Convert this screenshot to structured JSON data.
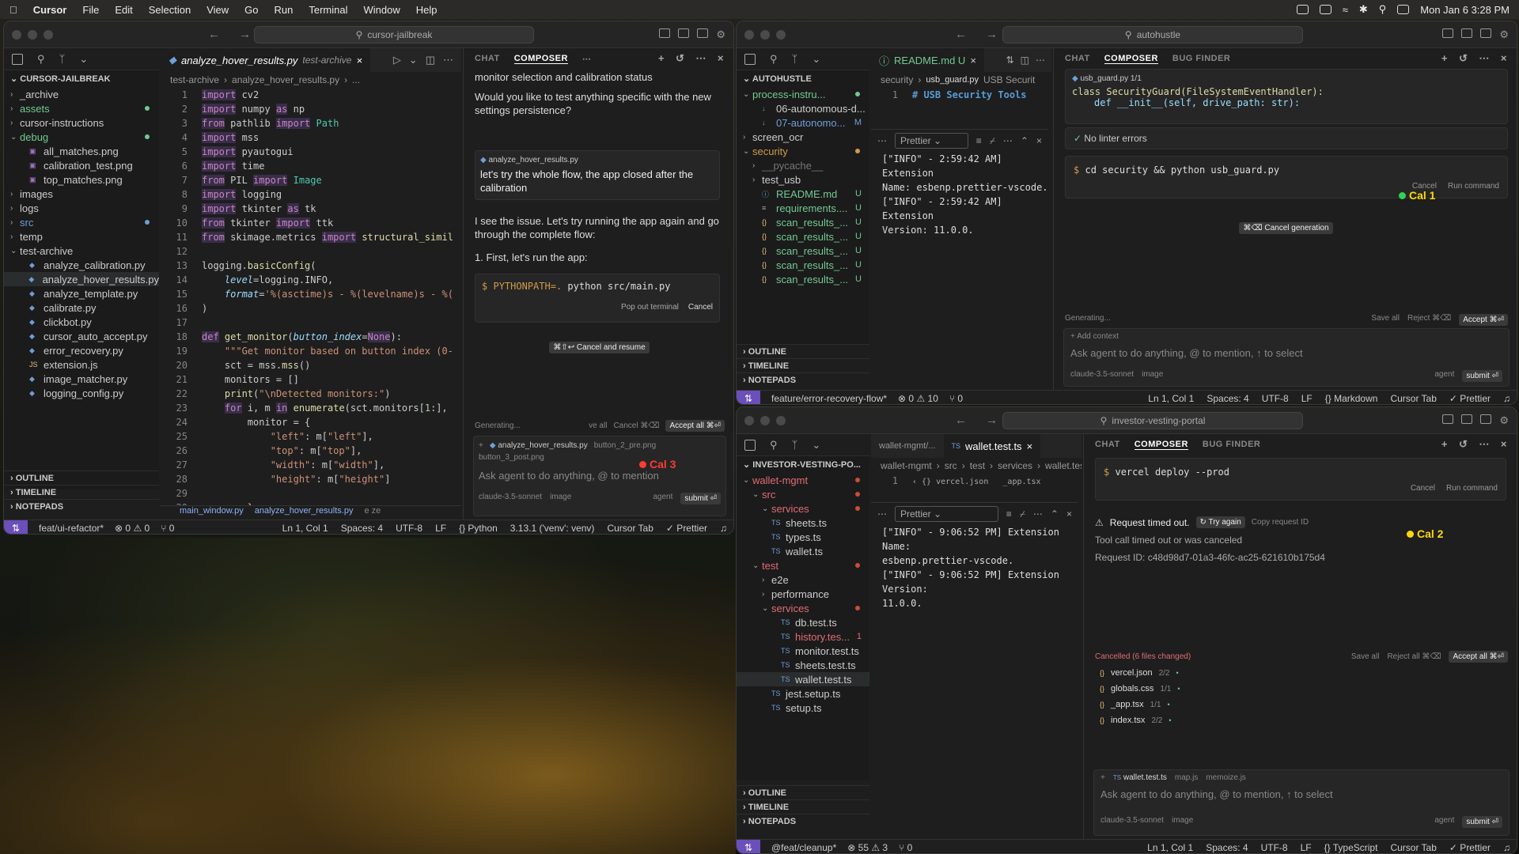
{
  "menubar": {
    "app": "Cursor",
    "items": [
      "File",
      "Edit",
      "Selection",
      "View",
      "Go",
      "Run",
      "Terminal",
      "Window",
      "Help"
    ],
    "clock": "Mon Jan 6  3:28 PM"
  },
  "win1": {
    "search": "cursor-jailbreak",
    "root": "CURSOR-JAILBREAK",
    "tree": [
      {
        "label": "_archive",
        "chev": ">",
        "indent": 0,
        "kind": "folder"
      },
      {
        "label": "assets",
        "chev": ">",
        "indent": 0,
        "kind": "folder",
        "color": "#73c991",
        "dot": "g"
      },
      {
        "label": "cursor-instructions",
        "chev": ">",
        "indent": 0,
        "kind": "folder"
      },
      {
        "label": "debug",
        "chev": "v",
        "indent": 0,
        "kind": "folder",
        "color": "#73c991",
        "dot": "g"
      },
      {
        "label": "all_matches.png",
        "indent": 1,
        "kind": "img"
      },
      {
        "label": "calibration_test.png",
        "indent": 1,
        "kind": "img"
      },
      {
        "label": "top_matches.png",
        "indent": 1,
        "kind": "img"
      },
      {
        "label": "images",
        "chev": ">",
        "indent": 0,
        "kind": "folder"
      },
      {
        "label": "logs",
        "chev": ">",
        "indent": 0,
        "kind": "folder"
      },
      {
        "label": "src",
        "chev": ">",
        "indent": 0,
        "kind": "folder",
        "color": "#6f9fd8",
        "dot": "b2"
      },
      {
        "label": "temp",
        "chev": ">",
        "indent": 0,
        "kind": "folder"
      },
      {
        "label": "test-archive",
        "chev": "v",
        "indent": 0,
        "kind": "folder"
      },
      {
        "label": "analyze_calibration.py",
        "indent": 1,
        "kind": "py"
      },
      {
        "label": "analyze_hover_results.py",
        "indent": 1,
        "kind": "py",
        "sel": true
      },
      {
        "label": "analyze_template.py",
        "indent": 1,
        "kind": "py"
      },
      {
        "label": "calibrate.py",
        "indent": 1,
        "kind": "py"
      },
      {
        "label": "clickbot.py",
        "indent": 1,
        "kind": "py"
      },
      {
        "label": "cursor_auto_accept.py",
        "indent": 1,
        "kind": "py"
      },
      {
        "label": "error_recovery.py",
        "indent": 1,
        "kind": "py"
      },
      {
        "label": "extension.js",
        "indent": 1,
        "kind": "js"
      },
      {
        "label": "image_matcher.py",
        "indent": 1,
        "kind": "py"
      },
      {
        "label": "logging_config.py",
        "indent": 1,
        "kind": "py"
      }
    ],
    "sections": [
      "OUTLINE",
      "TIMELINE",
      "NOTEPADS"
    ],
    "tab": {
      "name": "analyze_hover_results.py",
      "folder": "test-archive"
    },
    "breadcrumb": [
      "test-archive",
      "analyze_hover_results.py",
      "..."
    ],
    "code": [
      "<span class='kw'>import</span> cv2",
      "<span class='kw'>import</span> numpy <span class='kw'>as</span> np",
      "<span class='kw'>from</span> pathlib <span class='kw'>import</span> <span class='cls'>Path</span>",
      "<span class='kw'>import</span> mss",
      "<span class='kw'>import</span> pyautogui",
      "<span class='kw'>import</span> time",
      "<span class='kw'>from</span> PIL <span class='kw'>import</span> <span class='cls'>Image</span>",
      "<span class='kw'>import</span> logging",
      "<span class='kw'>import</span> tkinter <span class='kw'>as</span> tk",
      "<span class='kw'>from</span> tkinter <span class='kw'>import</span> ttk",
      "<span class='kw'>from</span> skimage.metrics <span class='kw'>import</span> <span class='fn'>structural_simil</span>",
      "",
      "logging.<span class='fn'>basicConfig</span>(",
      "    <span class='par'>level</span>=logging.INFO,",
      "    <span class='par'>format</span>=<span class='str'>'%(asctime)s - %(levelname)s - %(</span>",
      ")",
      "",
      "<span class='kw'>def</span> <span class='fn'>get_monitor</span>(<span class='par'>button_index</span>=<span class='kw'>None</span>):",
      "    <span class='str'>\"\"\"Get monitor based on button index (0-</span>",
      "    sct = mss.<span class='fn'>mss</span>()",
      "    monitors = []",
      "    <span class='fn'>print</span>(<span class='str'>\"\\nDetected monitors:\"</span>)",
      "    <span class='kw'>for</span> i, m <span class='kw'>in</span> <span class='fn'>enumerate</span>(sct.monitors[<span class='num'>1</span>:],",
      "        monitor = {",
      "            <span class='str'>\"left\"</span>: m[<span class='str'>\"left\"</span>],",
      "            <span class='str'>\"top\"</span>: m[<span class='str'>\"top\"</span>],",
      "            <span class='str'>\"width\"</span>: m[<span class='str'>\"width\"</span>],",
      "            <span class='str'>\"height\"</span>: m[<span class='str'>\"height\"</span>]",
      "",
      "        }"
    ],
    "sticky": [
      "main_window.py",
      "analyze_hover_results.py",
      "e ze"
    ],
    "chat": {
      "tabs": [
        "CHAT",
        "COMPOSER"
      ],
      "prev_text": "monitor selection and calibration status",
      "q": "Would you like to test anything specific with the new settings persistence?",
      "user_file": "analyze_hover_results.py",
      "user_msg": "let's try the whole flow, the app closed after the calibration",
      "reply": "I see the issue. Let's try running the app again and go through the complete flow:",
      "step": "1. First, let's run the app:",
      "cmd_prefix": "PYTHONPATH=.",
      "cmd_rest": "python src/main.py",
      "popout": "Pop out terminal",
      "cancel": "Cancel",
      "cancel_resume": "⌘⇧↩ Cancel and resume",
      "generating": "Generating...",
      "save_all": "ve all",
      "cancel_k": "Cancel ⌘⌫",
      "accept_all": "Accept all ⌘⏎",
      "ctx_files": [
        "analyze_hover_results.py",
        "button_2_pre.png",
        "button_3_post.png"
      ],
      "ask": "Ask agent to do anything, @ to mention",
      "model": "claude-3.5-sonnet",
      "image": "image",
      "agent": "agent",
      "submit": "submit ⏎"
    },
    "cal3": "Cal 3",
    "status": {
      "branch": "feat/ui-refactor*",
      "errors": "⊗ 0 ⚠ 0",
      "ports": "⑂ 0",
      "pos": "Ln 1, Col 1",
      "spaces": "Spaces: 4",
      "enc": "UTF-8",
      "eol": "LF",
      "lang": "{} Python",
      "ver": "3.13.1 ('venv': venv)",
      "tab": "Cursor Tab",
      "prettier": "✓ Prettier"
    }
  },
  "win2": {
    "search": "autohustle",
    "root": "AUTOHUSTLE",
    "tree": [
      {
        "label": "process-instru...",
        "chev": "v",
        "indent": 0,
        "kind": "folder",
        "color": "#73c991",
        "dot": "g"
      },
      {
        "label": "06-autonomous-d...",
        "indent": 1,
        "kind": "md"
      },
      {
        "label": "07-autonomo...",
        "indent": 1,
        "kind": "md",
        "color": "#6f9fd8",
        "badge": "M"
      },
      {
        "label": "screen_ocr",
        "chev": ">",
        "indent": 0,
        "kind": "folder"
      },
      {
        "label": "security",
        "chev": "v",
        "indent": 0,
        "kind": "folder",
        "color": "#d19a4b",
        "dot": "r"
      },
      {
        "label": "__pycache__",
        "chev": ">",
        "indent": 1,
        "kind": "folder",
        "color": "#777"
      },
      {
        "label": "test_usb",
        "chev": ">",
        "indent": 1,
        "kind": "folder"
      },
      {
        "label": "README.md",
        "indent": 1,
        "kind": "info",
        "color": "#73c991",
        "badge": "U"
      },
      {
        "label": "requirements....",
        "indent": 1,
        "kind": "txt",
        "color": "#73c991",
        "badge": "U"
      },
      {
        "label": "scan_results_...",
        "indent": 1,
        "kind": "json",
        "color": "#73c991",
        "badge": "U"
      },
      {
        "label": "scan_results_...",
        "indent": 1,
        "kind": "json",
        "color": "#73c991",
        "badge": "U"
      },
      {
        "label": "scan_results_...",
        "indent": 1,
        "kind": "json",
        "color": "#73c991",
        "badge": "U"
      },
      {
        "label": "scan_results_...",
        "indent": 1,
        "kind": "json",
        "color": "#73c991",
        "badge": "U"
      },
      {
        "label": "scan_results_...",
        "indent": 1,
        "kind": "json",
        "color": "#73c991",
        "badge": "U"
      }
    ],
    "sections": [
      "OUTLINE",
      "TIMELINE",
      "NOTEPADS"
    ],
    "tab": "README.md U",
    "crumb": [
      "security",
      "usb_guard.py",
      "USB Securit"
    ],
    "line1": "# USB Security Tools",
    "term_lines": [
      "[\"INFO\" - 2:59:42 AM] Extension",
      "Name: esbenp.prettier-vscode.",
      "[\"INFO\" - 2:59:42 AM] Extension",
      "Version: 11.0.0."
    ],
    "prettier": "Prettier",
    "chat": {
      "tabs": [
        "CHAT",
        "COMPOSER",
        "BUG FINDER"
      ],
      "file": "usb_guard.py",
      "file_count": "1/1",
      "code1": "class SecurityGuard(FileSystemEventHandler):",
      "code2": "def __init__(self, drive_path: str):",
      "lint": "No linter errors",
      "cmd": "cd security && python usb_guard.py",
      "cancel": "Cancel",
      "run": "Run command",
      "cancel_gen": "⌘⌫ Cancel generation",
      "generating": "Generating...",
      "save_all": "Save all",
      "reject": "Reject ⌘⌫",
      "accept": "Accept ⌘⏎",
      "add_ctx": "+ Add context",
      "ask": "Ask agent to do anything, @ to mention, ↑ to select",
      "model": "claude-3.5-sonnet",
      "image": "image",
      "agent": "agent",
      "submit": "submit ⏎"
    },
    "cal1": "Cal 1",
    "status": {
      "branch": "feature/error-recovery-flow*",
      "errors": "⊗ 0 ⚠ 10",
      "ports": "⑂ 0",
      "pos": "Ln 1, Col 1",
      "spaces": "Spaces: 4",
      "enc": "UTF-8",
      "eol": "LF",
      "lang": "{} Markdown",
      "tab": "Cursor Tab",
      "prettier": "✓ Prettier"
    }
  },
  "win3": {
    "search": "investor-vesting-portal",
    "root": "INVESTOR-VESTING-PO...",
    "tree": [
      {
        "label": "wallet-mgmt",
        "chev": "v",
        "indent": 0,
        "kind": "folder",
        "color": "#e06c75",
        "dot": "r"
      },
      {
        "label": "src",
        "chev": "v",
        "indent": 1,
        "kind": "folder",
        "color": "#e06c75",
        "dot": "r"
      },
      {
        "label": "services",
        "chev": "v",
        "indent": 2,
        "kind": "folder",
        "color": "#e06c75",
        "dot": "r"
      },
      {
        "label": "sheets.ts",
        "indent": 2,
        "kind": "ts"
      },
      {
        "label": "types.ts",
        "indent": 2,
        "kind": "ts"
      },
      {
        "label": "wallet.ts",
        "indent": 2,
        "kind": "ts"
      },
      {
        "label": "test",
        "chev": "v",
        "indent": 1,
        "kind": "folder",
        "color": "#e06c75",
        "dot": "r"
      },
      {
        "label": "e2e",
        "chev": ">",
        "indent": 2,
        "kind": "folder"
      },
      {
        "label": "performance",
        "chev": ">",
        "indent": 2,
        "kind": "folder"
      },
      {
        "label": "services",
        "chev": "v",
        "indent": 2,
        "kind": "folder",
        "color": "#e06c75",
        "dot": "r"
      },
      {
        "label": "db.test.ts",
        "indent": 3,
        "kind": "ts"
      },
      {
        "label": "history.tes...",
        "indent": 3,
        "kind": "ts",
        "color": "#e06c75",
        "badge": "1"
      },
      {
        "label": "monitor.test.ts",
        "indent": 3,
        "kind": "ts"
      },
      {
        "label": "sheets.test.ts",
        "indent": 3,
        "kind": "ts"
      },
      {
        "label": "wallet.test.ts",
        "indent": 3,
        "kind": "ts",
        "sel": true
      },
      {
        "label": "jest.setup.ts",
        "indent": 2,
        "kind": "ts"
      },
      {
        "label": "setup.ts",
        "indent": 2,
        "kind": "ts"
      }
    ],
    "sections": [
      "OUTLINE",
      "TIMELINE",
      "NOTEPADS"
    ],
    "tab_prev": "wallet-mgmt/...",
    "tab": "wallet.test.ts",
    "crumb": [
      "wallet-mgmt",
      "src",
      "test",
      "services",
      "wallet.test.ts"
    ],
    "peek_files": [
      "vercel.json",
      "_app.tsx"
    ],
    "term_lines": [
      "[\"INFO\" - 9:06:52 PM] Extension Name:",
      "esbenp.prettier-vscode.",
      "[\"INFO\" - 9:06:52 PM] Extension Version:",
      "11.0.0."
    ],
    "prettier": "Prettier",
    "chat": {
      "tabs": [
        "CHAT",
        "COMPOSER",
        "BUG FINDER"
      ],
      "cmd": "vercel deploy --prod",
      "cancel": "Cancel",
      "run": "Run command",
      "timeout": "Request timed out.",
      "try_again": "↻ Try again",
      "copy_id": "Copy request ID",
      "tool_msg": "Tool call timed out or was canceled",
      "req_id": "Request ID: c48d98d7-01a3-46fc-ac25-621610b175d4",
      "cancelled": "Cancelled (6 files changed)",
      "save_all": "Save all",
      "reject_all": "Reject all ⌘⌫",
      "accept_all": "Accept all ⌘⏎",
      "changed": [
        {
          "name": "vercel.json",
          "count": "2/2"
        },
        {
          "name": "globals.css",
          "count": "1/1"
        },
        {
          "name": "_app.tsx",
          "count": "1/1"
        },
        {
          "name": "index.tsx",
          "count": "2/2"
        }
      ],
      "ctx_files": [
        "wallet.test.ts",
        "map.js",
        "memoize.js"
      ],
      "ask": "Ask agent to do anything, @ to mention, ↑ to select",
      "model": "claude-3.5-sonnet",
      "image": "image",
      "agent": "agent",
      "submit": "submit ⏎"
    },
    "cal2": "Cal 2",
    "status": {
      "branch": "@feat/cleanup*",
      "errors": "⊗ 55 ⚠ 3",
      "ports": "⑂ 0",
      "pos": "Ln 1, Col 1",
      "spaces": "Spaces: 4",
      "enc": "UTF-8",
      "eol": "LF",
      "lang": "{} TypeScript",
      "tab": "Cursor Tab",
      "prettier": "✓ Prettier"
    }
  }
}
